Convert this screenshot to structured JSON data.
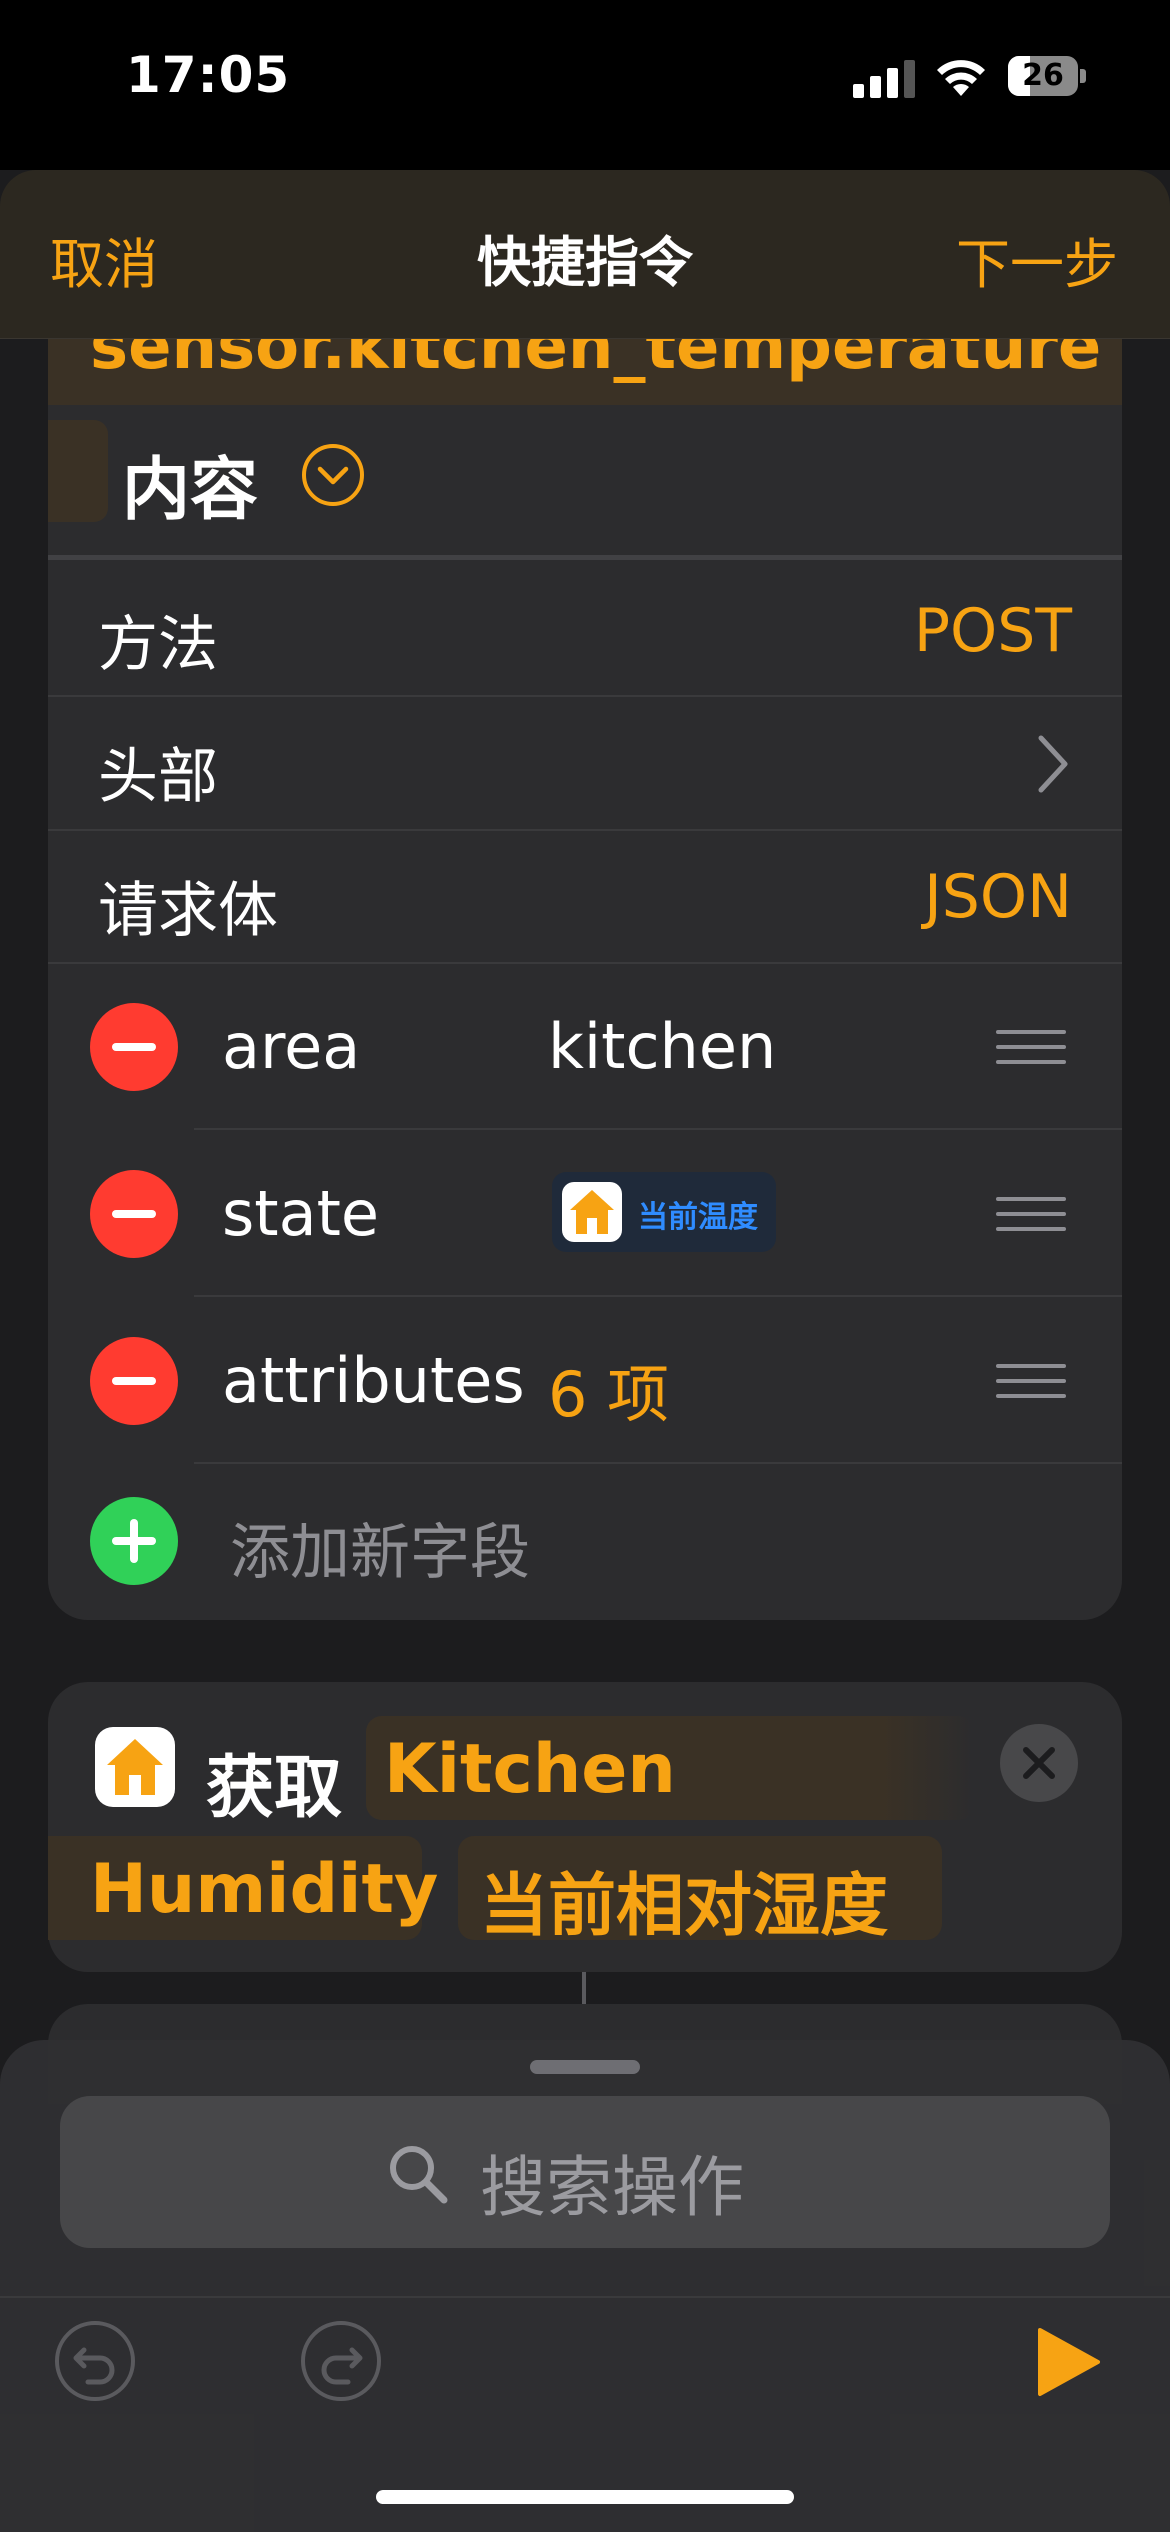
{
  "status_bar": {
    "time": "17:05",
    "battery": "26"
  },
  "nav": {
    "cancel": "取消",
    "title": "快捷指令",
    "next": "下一步"
  },
  "request": {
    "url_token": "sensor.kitchen_temperature",
    "content_label": "内容",
    "rows": [
      {
        "label": "方法",
        "value": "POST"
      },
      {
        "label": "头部",
        "value": ""
      },
      {
        "label": "请求体",
        "value": "JSON"
      }
    ],
    "fields": [
      {
        "key": "area",
        "value": "kitchen"
      },
      {
        "key": "state",
        "token": "当前温度"
      },
      {
        "key": "attributes",
        "value": "6 项"
      }
    ],
    "add_field": "添加新字段"
  },
  "action": {
    "verb": "获取",
    "token_device_line1": "Kitchen",
    "token_device_line2": "Humidity",
    "token_property": "当前相对湿度"
  },
  "bottom_panel": {
    "search_placeholder": "搜索操作"
  },
  "colors": {
    "accent": "#f7a313",
    "destructive": "#ff3b30",
    "add": "#30d158",
    "token_blue": "#2f8cff"
  },
  "icons": [
    "signal-icon",
    "wifi-icon",
    "battery-icon",
    "chevron-down-circle-icon",
    "chevron-right-icon",
    "drag-handle-icon",
    "home-icon",
    "close-icon",
    "search-icon",
    "undo-icon",
    "redo-icon",
    "play-icon"
  ]
}
